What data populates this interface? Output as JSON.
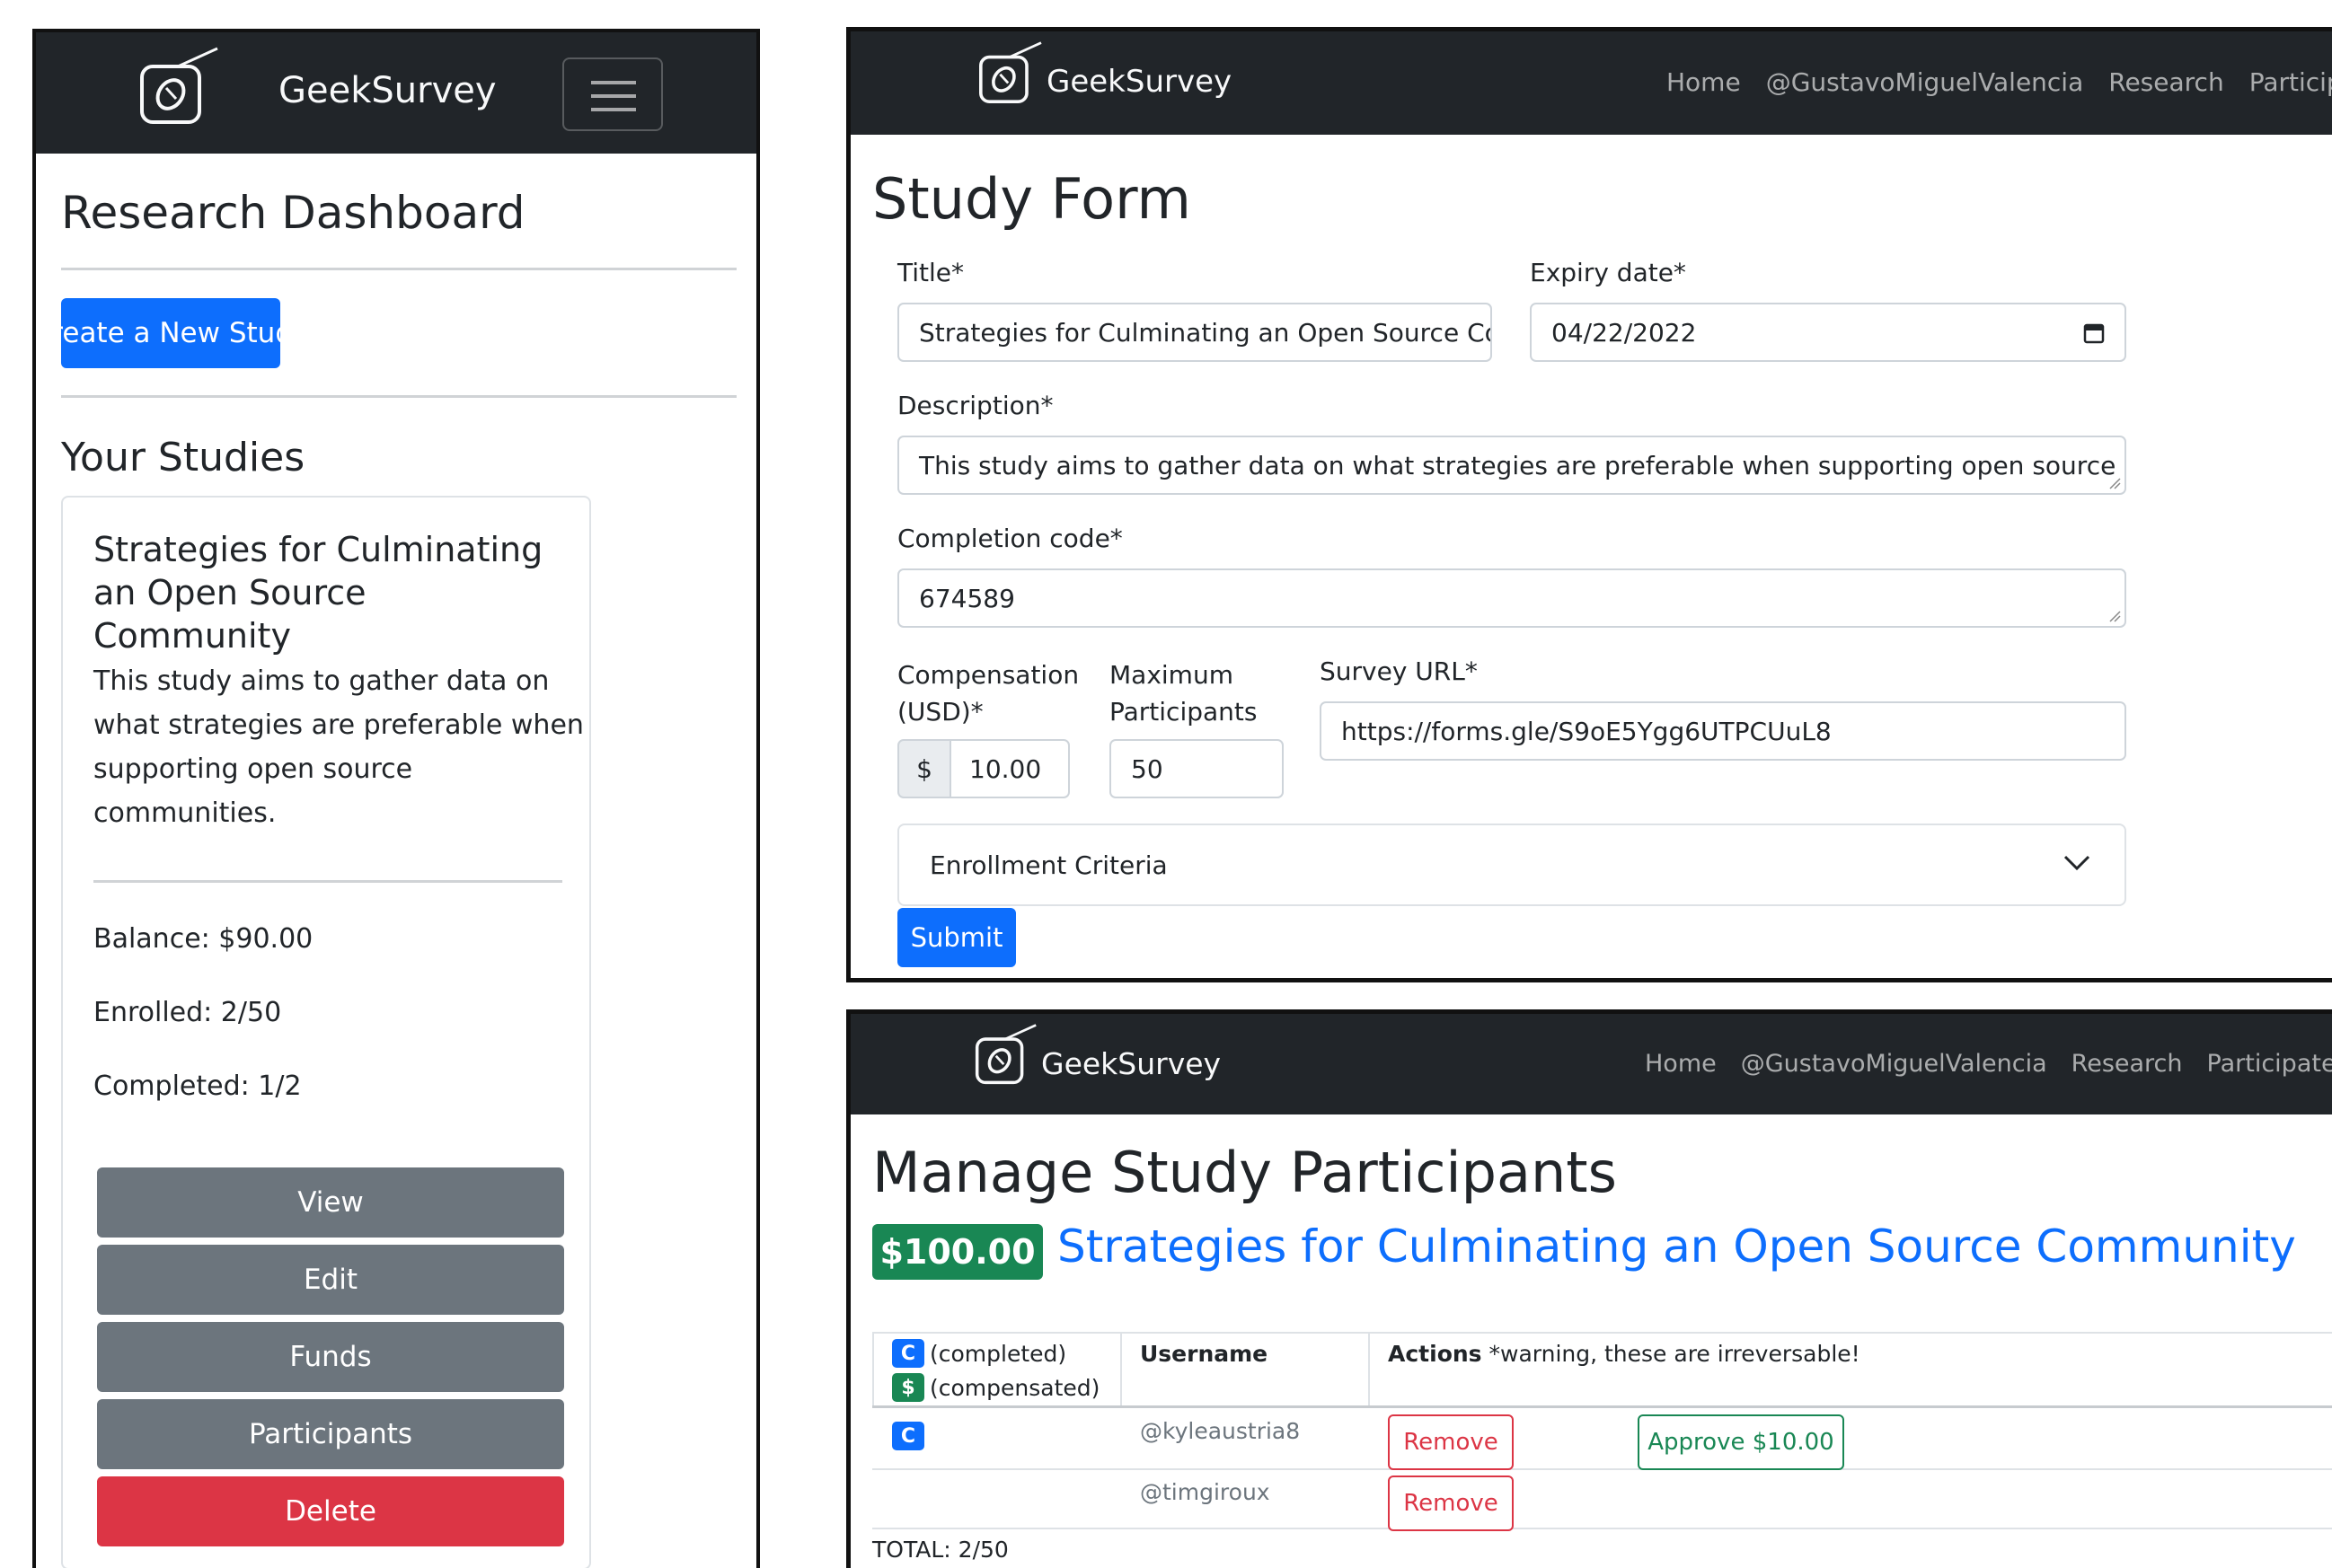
{
  "brand": "GeekSurvey",
  "nav": [
    "Home",
    "@GustavoMiguelValencia",
    "Research",
    "Participate"
  ],
  "dashboard": {
    "title": "Research Dashboard",
    "create_button": "Create a New Study",
    "studies_heading": "Your Studies",
    "card": {
      "title_lines": [
        "Strategies for Culminating",
        "an Open Source",
        "Community"
      ],
      "desc_lines": [
        "This study aims to gather data on",
        "what strategies are preferable when",
        "supporting open source",
        "communities."
      ],
      "balance": "Balance: $90.00",
      "enrolled": "Enrolled: 2/50",
      "completed": "Completed: 1/2",
      "buttons": [
        "View",
        "Edit",
        "Funds",
        "Participants",
        "Delete"
      ]
    }
  },
  "form": {
    "title": "Study Form",
    "title_label": "Title*",
    "title_value": "Strategies for Culminating an Open Source Commu",
    "expiry_label": "Expiry date*",
    "expiry_value": "04/22/2022",
    "desc_label": "Description*",
    "desc_value": "This study aims to gather data on what strategies are preferable when supporting open source communities.",
    "code_label": "Completion code*",
    "code_value": "674589",
    "comp_label_1": "Compensation",
    "comp_label_2": "(USD)*",
    "comp_prefix": "$",
    "comp_value": "10.00",
    "max_label_1": "Maximum",
    "max_label_2": "Participants",
    "max_value": "50",
    "url_label": "Survey URL*",
    "url_value": "https://forms.gle/S9oE5Ygg6UTPCUuL8",
    "enrollment": "Enrollment Criteria",
    "submit": "Submit"
  },
  "manage": {
    "title": "Manage Study Participants",
    "amount": "$100.00",
    "study_link": "Strategies for Culminating an Open Source Community",
    "legend_c": "C",
    "legend_completed": "(completed)",
    "legend_s": "$",
    "legend_compensated": "(compensated)",
    "col_username": "Username",
    "col_actions": "Actions",
    "col_warning": "*warning, these are irreversable!",
    "rows": [
      {
        "badge": "C",
        "username": "@kyleaustria8",
        "remove": "Remove",
        "approve": "Approve $10.00"
      },
      {
        "badge": "",
        "username": "@timgiroux",
        "remove": "Remove",
        "approve": ""
      }
    ],
    "total": "TOTAL: 2/50"
  },
  "colors": {
    "navbar": "#212529",
    "primary": "#0d6efd",
    "secondary": "#6c757d",
    "danger": "#dc3545",
    "success": "#198754"
  }
}
